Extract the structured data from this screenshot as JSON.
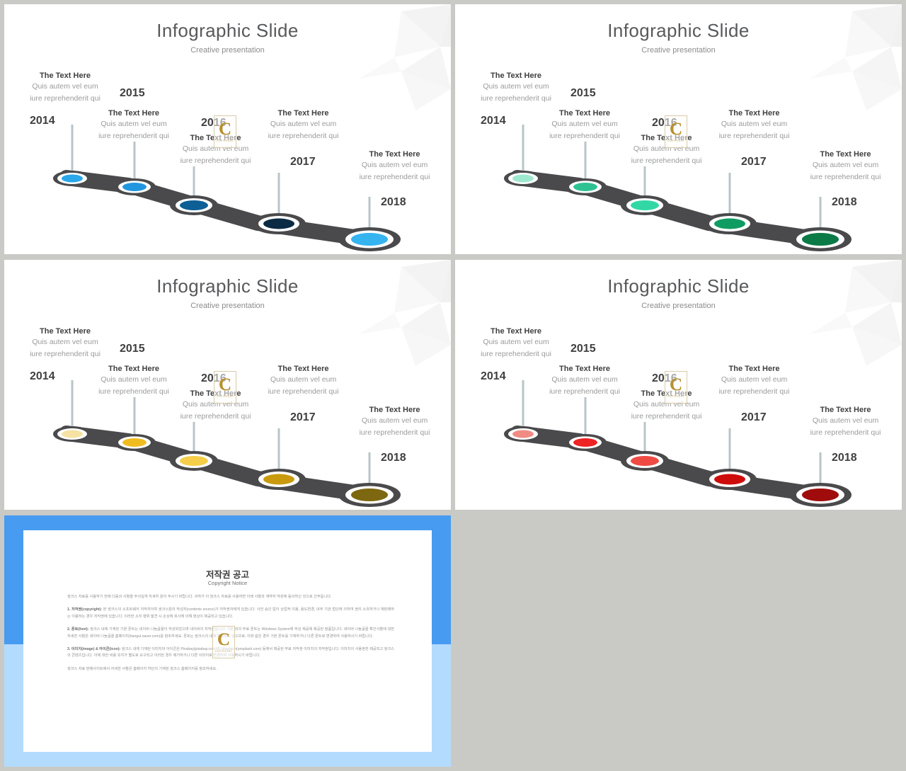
{
  "meta": {
    "canvas_bg": "#c9cac6",
    "slide_bg": "#ffffff"
  },
  "slide": {
    "title": "Infographic Slide",
    "subtitle": "Creative presentation",
    "steps": [
      {
        "year": "2014",
        "heading": "The Text Here",
        "line1": "Quis autem vel eum",
        "line2": "iure reprehenderit qui"
      },
      {
        "year": "2015",
        "heading": "The Text Here",
        "line1": "Quis autem vel eum",
        "line2": "iure reprehenderit qui"
      },
      {
        "year": "2016",
        "heading": "The Text Here",
        "line1": "Quis autem vel eum",
        "line2": "iure reprehenderit qui"
      },
      {
        "year": "2017",
        "heading": "The Text Here",
        "line1": "Quis autem vel eum",
        "line2": "iure reprehenderit qui"
      },
      {
        "year": "2018",
        "heading": "The Text Here",
        "line1": "Quis autem vel eum",
        "line2": "iure reprehenderit qui"
      }
    ]
  },
  "variants": [
    {
      "name": "blue",
      "road": "#4a4a4c",
      "dots": [
        "#29a7e8",
        "#2196e0",
        "#0d5f96",
        "#0b2b45",
        "#35b4f0",
        "#0e3a5c"
      ]
    },
    {
      "name": "green",
      "road": "#4a4a4c",
      "dots": [
        "#9fe8d0",
        "#2ec292",
        "#31d8a6",
        "#0f9c63",
        "#0a7a46",
        "#0d6b3e"
      ]
    },
    {
      "name": "yellow",
      "road": "#4a4a4c",
      "dots": [
        "#f6e2a2",
        "#f0bd20",
        "#f5cf4a",
        "#c99a0e",
        "#7d6710",
        "#8a7310"
      ]
    },
    {
      "name": "red",
      "road": "#4a4a4c",
      "dots": [
        "#f08b84",
        "#ee2323",
        "#ef4b44",
        "#cf0c0c",
        "#a00c0c",
        "#8e0b0b"
      ]
    }
  ],
  "watermark": {
    "letter": "C",
    "caption": "COPYRIGHT"
  },
  "copyright": {
    "title": "저작권 공고",
    "subtitle": "Copyright Notice",
    "intro": "씽크스 자료를 사용하기 전에 다음의 사항을 주의깊게 자세히 읽어 주시기 바랍니다. 귀하가 이 씽크스 자료를 사용하면 아래 사항과 계약자 약관에 동의하신 것으로 간주됩니다.",
    "sections": [
      {
        "label": "1. 저작권(copyright):",
        "text": "본 씽크스의 소프트웨어 저작자이며 씽크스원의 작성자(contents source)가 저작권자에게 있습니다. 사전 승인 없이 상업적 이용, 용도변경, 내부 기관·법인에 의하여 권리 소유하거나 재판매하는 이용하는 경우 저작권에 있습니다. 이러한 소지 행위 발견 시 손상에 회사에 의해 영상이 제공되고 있습니다."
      },
      {
        "label": "2. 폰트(font):",
        "text": "씽크스 내에 기재된 기본 폰트는 네이버 나눔글꼴이 작성되었으며 네이버의 저작권입니다. 기본 외의 무료 폰트는 Windows System에 무상 제공에 제공된 정품입니다. 네이버 나눔글꼴 확인사항에 대한 자세한 사항은 네이버 나눔글꼴 홈페이지(hangul.naver.com)를 참조하세요. 폰트는 씽크스의 내에 제공되지 않으므로, 이와 같은 경우 기본 폰트를 기재하거나 다른 폰트로 변경하여 사용하시기 바랍니다."
      },
      {
        "label": "3. 이미지(image) & 아이콘(icon):",
        "text": "씽크스 내에 기재된 이미지와 아이콘은 Pixabay(pixabay.com)와 Unsplash(unsplash.com) 등에서 제공된 무료 저작권 이미지의 저작권입니다. 이미지의 사용권한 제공되고 씽크스의 콘텐츠입니다. 이에 대한 비용 유지가 별도로 요구되고 이러한 경우 제거하거나 다른 이미지로 변경하여 사용하시기 바랍니다."
      }
    ],
    "footer": "씽크스 자료 판매사이트에서 자세한 사항은 홈페이지 하단의 기재된 씽크스 홈페이지를 참조하세요."
  }
}
